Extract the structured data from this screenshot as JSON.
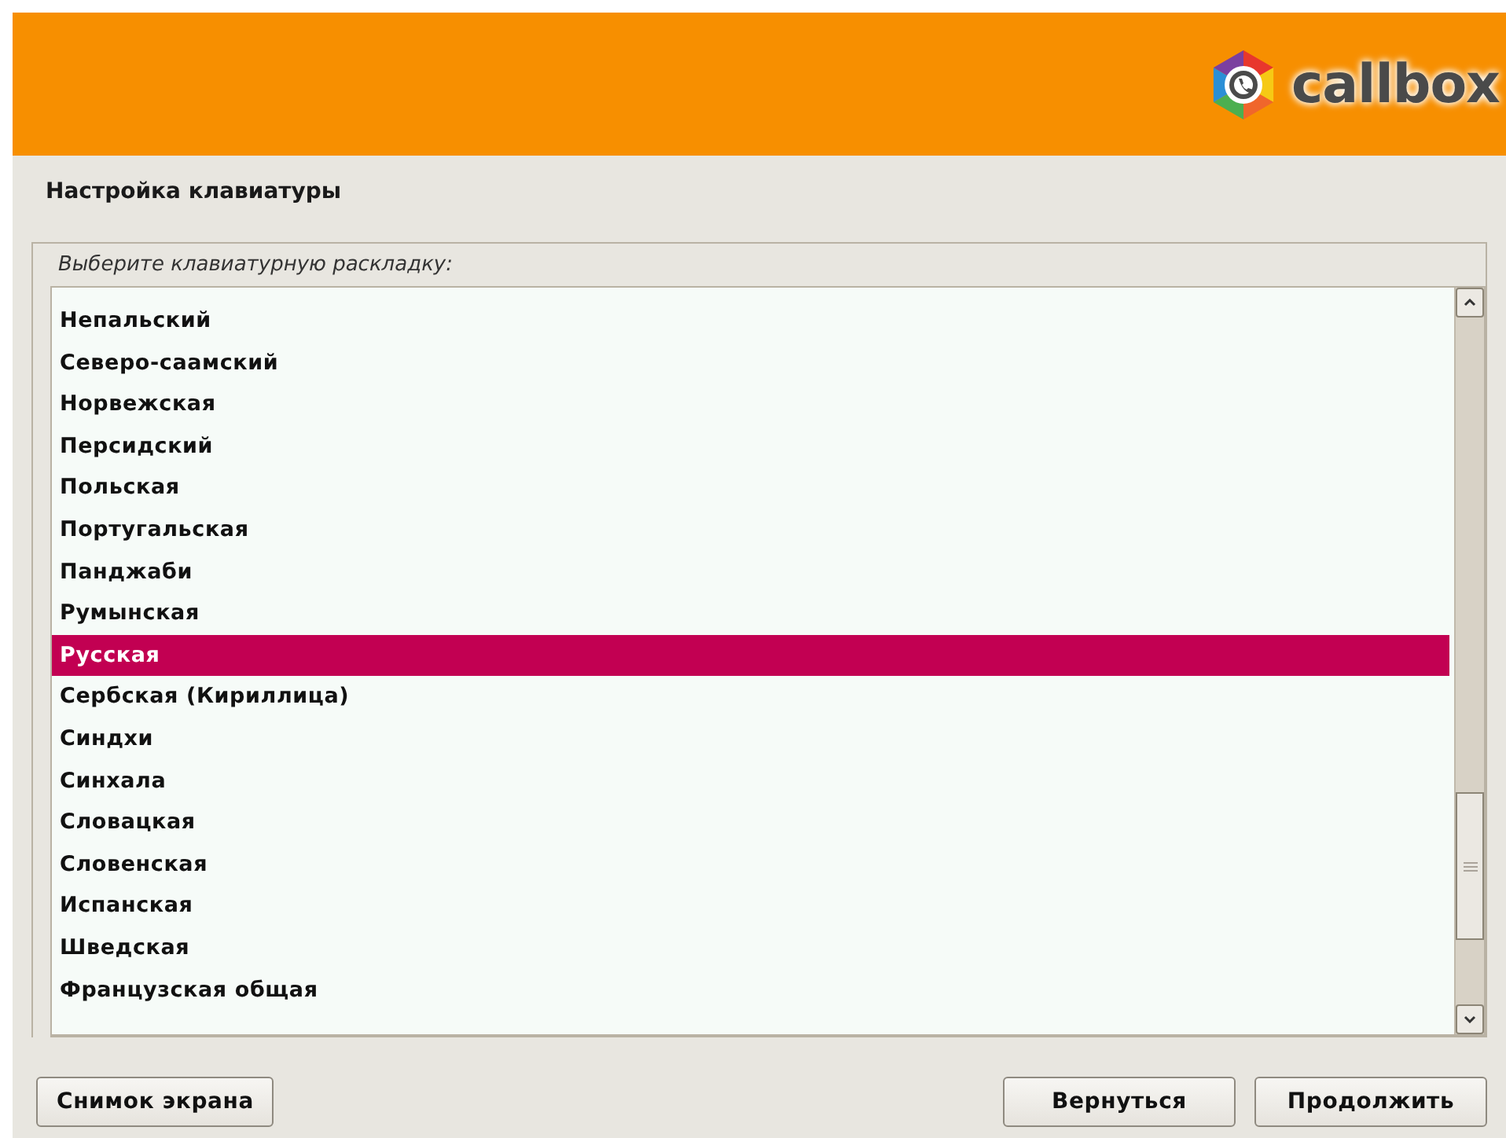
{
  "header": {
    "logo_text": "callbox"
  },
  "title": "Настройка клавиатуры",
  "prompt": "Выберите клавиатурную раскладку:",
  "layouts": [
    {
      "label": "Непальский",
      "selected": false
    },
    {
      "label": "Северо-саамский",
      "selected": false
    },
    {
      "label": "Норвежская",
      "selected": false
    },
    {
      "label": "Персидский",
      "selected": false
    },
    {
      "label": "Польская",
      "selected": false
    },
    {
      "label": "Португальская",
      "selected": false
    },
    {
      "label": "Панджаби",
      "selected": false
    },
    {
      "label": "Румынская",
      "selected": false
    },
    {
      "label": "Русская",
      "selected": true
    },
    {
      "label": "Сербская (Кириллица)",
      "selected": false
    },
    {
      "label": "Синдхи",
      "selected": false
    },
    {
      "label": "Синхала",
      "selected": false
    },
    {
      "label": "Словацкая",
      "selected": false
    },
    {
      "label": "Словенская",
      "selected": false
    },
    {
      "label": "Испанская",
      "selected": false
    },
    {
      "label": "Шведская",
      "selected": false
    },
    {
      "label": "Французская общая",
      "selected": false
    }
  ],
  "buttons": {
    "screenshot": "Снимок экрана",
    "back": "Вернуться",
    "continue": "Продолжить"
  }
}
